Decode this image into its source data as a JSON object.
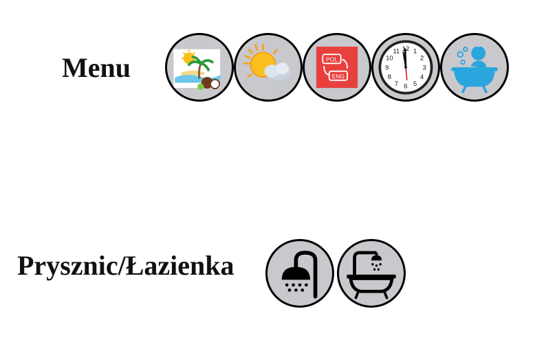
{
  "menu": {
    "label": "Menu",
    "items": [
      {
        "icon": "beach-vacation-icon"
      },
      {
        "icon": "weather-icon"
      },
      {
        "icon": "language-switch-icon",
        "lang_from": "POL",
        "lang_to": "ENG"
      },
      {
        "icon": "clock-icon",
        "clock_numbers": [
          "12",
          "1",
          "2",
          "3",
          "4",
          "5",
          "6",
          "7",
          "8",
          "9",
          "10",
          "11"
        ]
      },
      {
        "icon": "baby-bath-icon"
      }
    ]
  },
  "shower": {
    "label": "Prysznic/Łazienka",
    "items": [
      {
        "icon": "shower-icon"
      },
      {
        "icon": "bathtub-icon"
      }
    ]
  },
  "colors": {
    "circle_bg": "#c9c8cc",
    "circle_border": "#000000",
    "language_red": "#e8403f",
    "bath_blue": "#2aa5de"
  }
}
